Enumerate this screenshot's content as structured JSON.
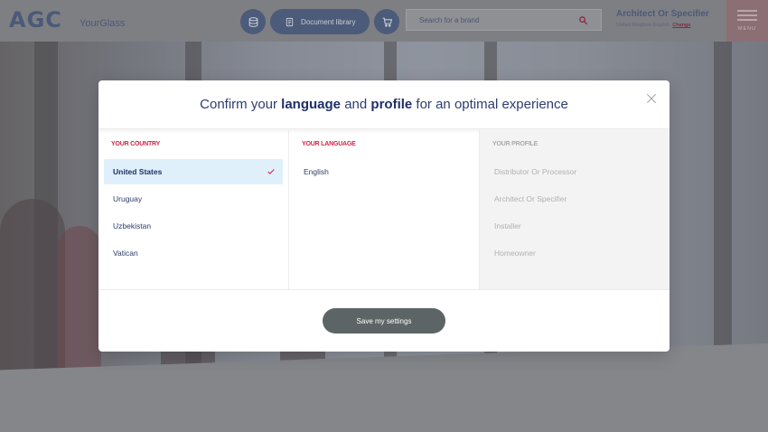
{
  "header": {
    "logo": "AGC",
    "brand": "YourGlass",
    "document_library_label": "Document library",
    "search_placeholder": "Search for a brand",
    "profile_title": "Architect Or Specifier",
    "profile_locale": "United Kingdom English",
    "change_label": "Change",
    "menu_label": "MENU",
    "icons": [
      "layers-icon",
      "document-icon",
      "cart-icon",
      "search-icon",
      "hamburger-icon"
    ]
  },
  "modal": {
    "title_parts": [
      "Confirm your ",
      "language",
      " and ",
      "profile",
      " for an optimal experience"
    ],
    "columns": [
      {
        "heading": "YOUR COUNTRY",
        "options": [
          {
            "label": "United States",
            "selected": true
          },
          {
            "label": "Uruguay",
            "selected": false
          },
          {
            "label": "Uzbekistan",
            "selected": false
          },
          {
            "label": "Vatican",
            "selected": false
          }
        ]
      },
      {
        "heading": "YOUR LANGUAGE",
        "options": [
          {
            "label": "English",
            "selected": false
          }
        ]
      },
      {
        "heading": "YOUR PROFILE",
        "options": [
          {
            "label": "Distributor Or Processor",
            "selected": false
          },
          {
            "label": "Architect Or Specifier",
            "selected": false
          },
          {
            "label": "Installer",
            "selected": false
          },
          {
            "label": "Homeowner",
            "selected": false
          }
        ]
      }
    ],
    "save_label": "Save my settings"
  },
  "colors": {
    "accent_red": "#d2234a",
    "navy": "#1f2f6a",
    "selected_bg": "#dff0fb",
    "save_button": "#5c6466"
  }
}
